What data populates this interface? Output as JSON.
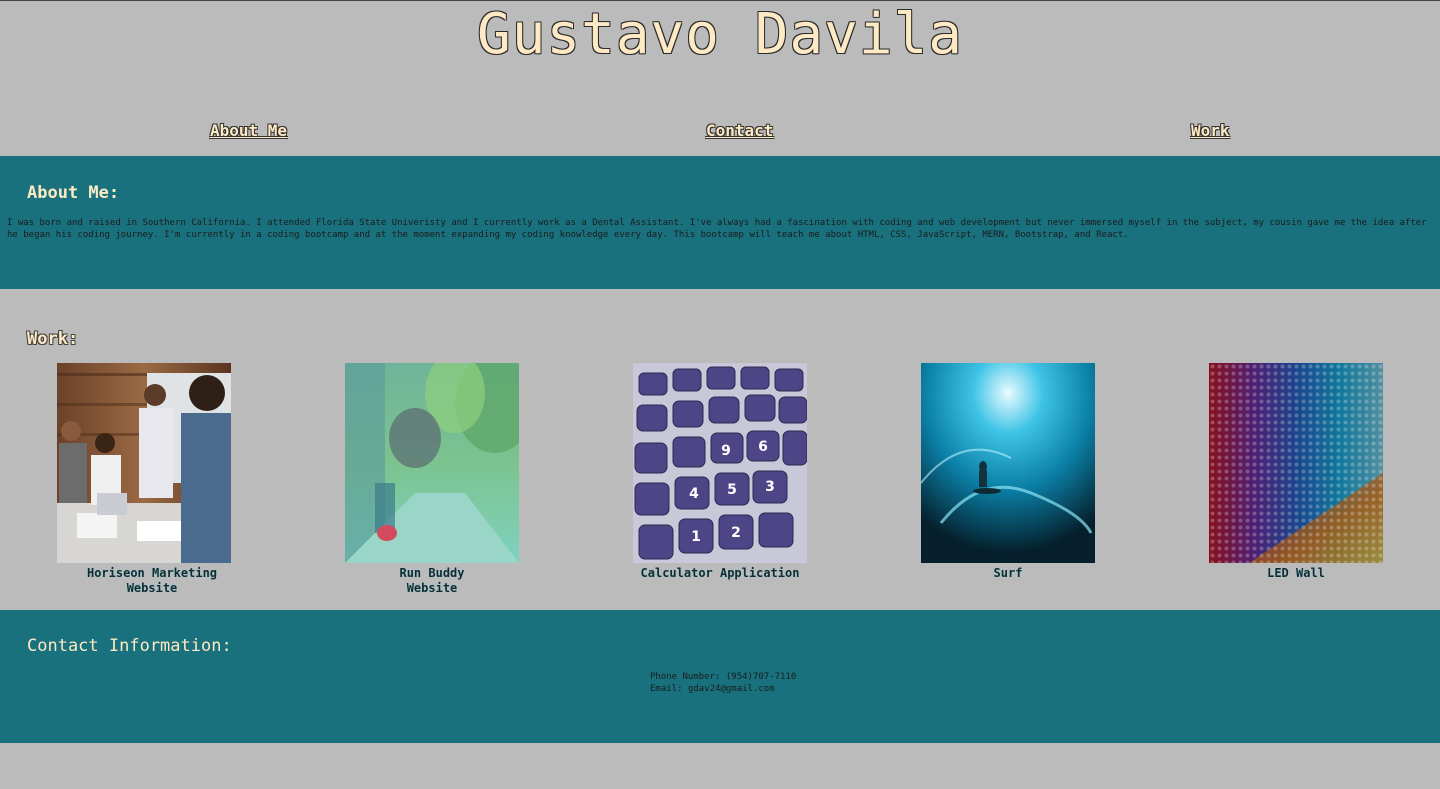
{
  "header": {
    "title": "Gustavo Davila"
  },
  "nav": {
    "about": "About Me",
    "contact": "Contact",
    "work": "Work"
  },
  "about": {
    "heading": "About Me:",
    "text": "I was born and raised in Southern California. I attended Florida State Univeristy and I currently work as a Dental Assistant. I've always had a fascination with coding and web development but never immersed myself in the subject, my cousin gave me the idea after he began his coding journey. I'm currently in a coding bootcamp and at the moment expanding my coding knowledge every day. This bootcamp will teach me about HTML, CSS, JavaScript, MERN, Bootstrap, and React."
  },
  "work": {
    "heading": "Work:",
    "projects": [
      {
        "caption_line1": "Horiseon Marketing",
        "caption_line2": "Website",
        "image": "office-team-photo"
      },
      {
        "caption_line1": "Run Buddy",
        "caption_line2": "Website",
        "image": "runner-photo"
      },
      {
        "caption_line1": "Calculator Application",
        "caption_line2": "",
        "image": "calculator-photo"
      },
      {
        "caption_line1": "Surf",
        "caption_line2": "",
        "image": "surf-wave-photo"
      },
      {
        "caption_line1": "LED Wall",
        "caption_line2": "",
        "image": "led-wall-photo"
      }
    ]
  },
  "contact": {
    "heading": "Contact Information:",
    "phone": "Phone Number: (954)707-7110",
    "email": "Email: gdav24@gmail.com"
  },
  "colors": {
    "page_background": "#bbbbbb",
    "section_teal": "#18717d",
    "heading_cream": "#fde9c3"
  }
}
